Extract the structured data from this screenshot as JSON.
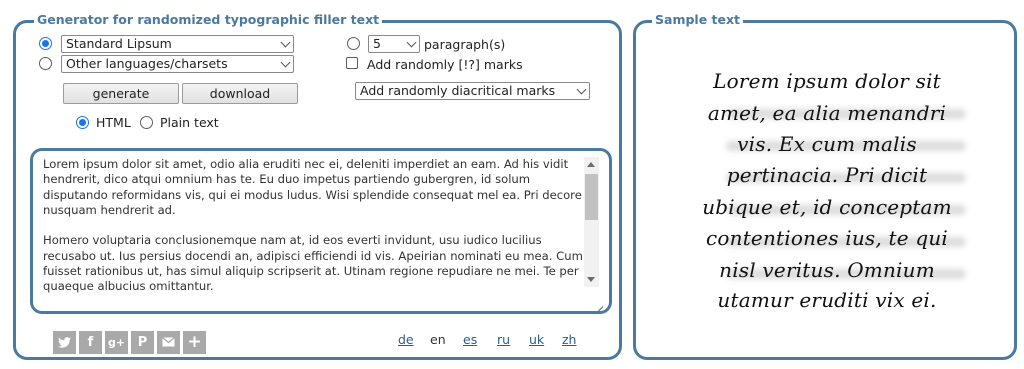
{
  "generator": {
    "legend": "Generator for randomized typographic filler text",
    "source_select": {
      "value": "Standard Lipsum",
      "selected": true
    },
    "languages_select": {
      "value": "Other languages/charsets",
      "selected": false
    },
    "count_select": {
      "value": "5"
    },
    "unit_label": "paragraph(s)",
    "random_marks_label": "Add randomly [!?] marks",
    "diacritics_select": {
      "value": "Add randomly diacritical marks"
    },
    "generate_label": "generate",
    "download_label": "download",
    "format_html_label": "HTML",
    "format_plain_label": "Plain text",
    "output_paragraphs": [
      "Lorem ipsum dolor sit amet, odio alia eruditi nec ei, deleniti imperdiet an eam. Ad his vidit hendrerit, dico atqui omnium has te. Eu duo impetus partiendo gubergren, id solum disputando reformidans vis, qui ei modus ludus. Wisi splendide consequat mel ea. Pri decore nusquam hendrerit ad.",
      "Homero voluptaria conclusionemque nam at, id eos everti invidunt, usu iudico lucilius recusabo ut. Ius persius docendi an, adipisci efficiendi id vis. Apeirian nominati eu mea. Cum fuisset rationibus ut, has simul aliquip scripserit at. Utinam regione repudiare ne mei. Te per quaeque albucius omittantur."
    ],
    "share_icons": [
      "twitter-icon",
      "facebook-icon",
      "google-plus-icon",
      "pinterest-icon",
      "email-icon",
      "plus-icon"
    ],
    "languages": [
      "de",
      "en",
      "es",
      "ru",
      "uk",
      "zh"
    ],
    "accent_color": "#4a7aa0"
  },
  "sample": {
    "legend": "Sample text",
    "lines": [
      "Lorem ipsum dolor sit",
      "amet, ea alia menandri",
      "vis. Ex cum malis",
      "pertinacia. Pri dicit",
      "ubique et, id conceptam",
      "contentiones ius, te qui",
      "nisl veritus. Omnium",
      "utamur eruditi vix ei."
    ]
  }
}
